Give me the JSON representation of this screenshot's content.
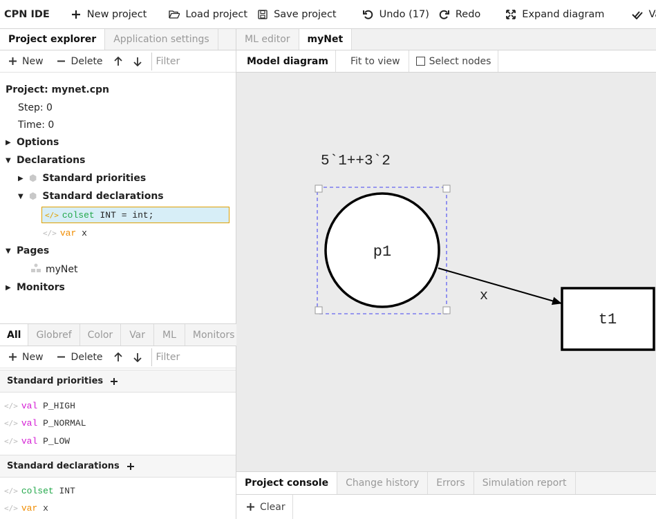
{
  "toolbar": {
    "app_title": "CPN IDE",
    "new_project": "New project",
    "load_project": "Load project",
    "save_project": "Save project",
    "undo": "Undo (17)",
    "redo": "Redo",
    "expand_diagram": "Expand diagram",
    "validate": "Validate"
  },
  "explorer": {
    "tabs": [
      "Project explorer",
      "Application settings"
    ],
    "new_label": "New",
    "delete_label": "Delete",
    "filter_placeholder": "Filter",
    "project_label": "Project: mynet.cpn",
    "step_label": "Step: 0",
    "time_label": "Time: 0",
    "options_label": "Options",
    "declarations_label": "Declarations",
    "standard_priorities_label": "Standard priorities",
    "standard_declarations_label": "Standard declarations",
    "decl_colset_kw": "colset",
    "decl_colset_rest": " INT = int;",
    "decl_var_kw": "var",
    "decl_var_rest": " x",
    "pages_label": "Pages",
    "page_mynet": "myNet",
    "monitors_label": "Monitors"
  },
  "declarations_panel": {
    "tabs": [
      "All",
      "Globref",
      "Color",
      "Var",
      "ML",
      "Monitors"
    ],
    "new_label": "New",
    "delete_label": "Delete",
    "filter_placeholder": "Filter",
    "priorities_header": "Standard priorities",
    "priorities": [
      {
        "kw": "val",
        "name": " P_HIGH"
      },
      {
        "kw": "val",
        "name": " P_NORMAL"
      },
      {
        "kw": "val",
        "name": " P_LOW"
      }
    ],
    "declarations_header": "Standard declarations",
    "declarations": [
      {
        "kw": "colset",
        "name": " INT"
      },
      {
        "kw": "var",
        "name": " x"
      }
    ]
  },
  "editor": {
    "tabs": [
      "ML editor",
      "myNet"
    ],
    "model_diagram": "Model diagram",
    "fit_to_view": "Fit to view",
    "select_nodes": "Select nodes"
  },
  "diagram": {
    "marking": "5`1++3`2",
    "place_label": "p1",
    "arc_label": "x",
    "transition_label": "t1"
  },
  "console": {
    "tabs": [
      "Project console",
      "Change history",
      "Errors",
      "Simulation report"
    ],
    "clear_label": "Clear"
  },
  "colors": {
    "selection": "#7b7bf0",
    "code_green": "#22a84a",
    "code_orange": "#f08c00",
    "code_magenta": "#d41cd4",
    "selected_row_bg": "#d7eef7",
    "selected_row_border": "#e0a000"
  }
}
